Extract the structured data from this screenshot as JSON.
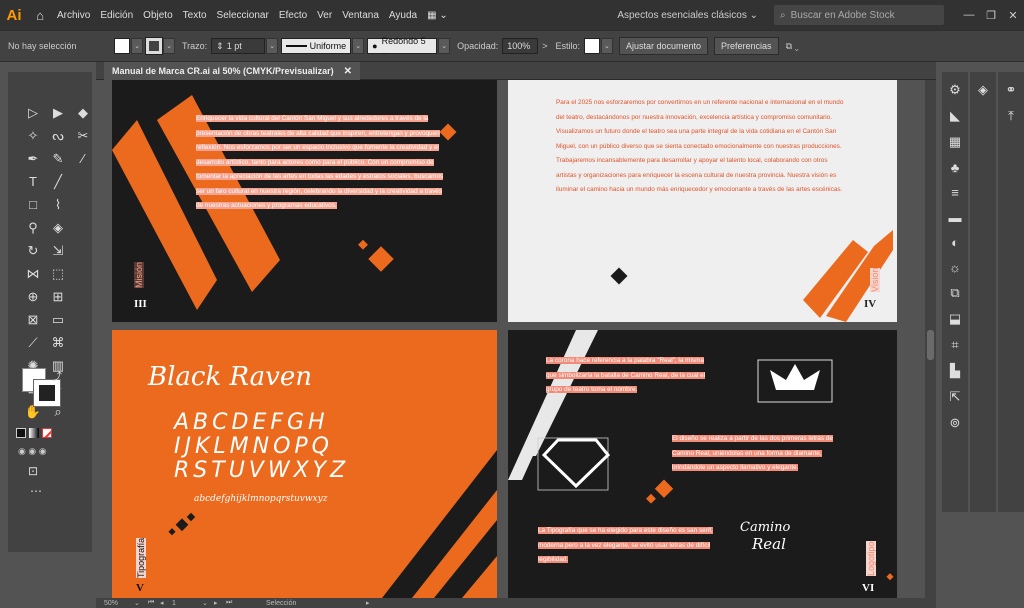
{
  "menubar": {
    "logo": "Ai",
    "items": [
      "Archivo",
      "Edición",
      "Objeto",
      "Texto",
      "Seleccionar",
      "Efecto",
      "Ver",
      "Ventana",
      "Ayuda"
    ],
    "workspace": "Aspectos esenciales clásicos",
    "search_placeholder": "Buscar en Adobe Stock"
  },
  "controlbar": {
    "selection_status": "No hay selección",
    "stroke_label": "Trazo:",
    "stroke_value": "1 pt",
    "profile": "Uniforme",
    "brush": "Redondo 5 ...",
    "opacity_label": "Opacidad:",
    "opacity_value": "100%",
    "style_label": "Estilo:",
    "doc_setup_button": "Ajustar documento",
    "prefs_button": "Preferencias"
  },
  "document": {
    "tab_title": "Manual de Marca CR.ai al 50% (CMYK/Previsualizar)"
  },
  "artboards": {
    "a3": {
      "label": "Misión",
      "number": "III",
      "text": "Enriquecer la vida cultural del Cantón San Miguel y sus alrededores a través de la presentación de obras teatrales de alta calidad que inspiren, entretengan y provoquen reflexión. Nos esforzamos por ser un espacio inclusivo que fomente la creatividad y el desarrollo artístico, tanto para actores como para el público. Con un compromiso de fomentar la apreciación de las artes en todas las edades y estratos sociales, buscamos ser un faro cultural en nuestra región, celebrando la diversidad y la creatividad a través de nuestras actuaciones y programas educativos."
    },
    "a4": {
      "label": "Visión",
      "number": "IV",
      "text": "Para el 2025 nos esforzaremos por convertirnos en un referente nacional e internacional en el mundo del teatro, destacándonos por nuestra innovación, excelencia artística y compromiso comunitario. Visualizamos un futuro donde el teatro sea una parte integral de la vida cotidiana en el Cantón San Miguel, con un público diverso que se sienta conectado emocionalmente con nuestras producciones. Trabajaremos incansablemente para desarrollar y apoyar el talento local, colaborando con otros artistas y organizaciones para enriquecer la escena cultural de nuestra provincia. Nuestra visión es iluminar el camino hacia un mundo más enriquecedor y emocionante a través de las artes escénicas."
    },
    "a5": {
      "label": "Tipografía",
      "number": "V",
      "title": "Black Raven",
      "upper1": "ABCDEFGH",
      "upper2": "IJKLMNOPQ",
      "upper3": "RSTUVWXYZ",
      "lower": "abcdefghijklmnopqrstuvwxyz"
    },
    "a6": {
      "label": "Logotipo",
      "number": "VI",
      "crown_text": "La corona hace referencia a la palabra \"Real\", la misma que simbolizaría la batalla de Camino Real, de la cual el grupo de teatro toma el nombre.",
      "design_text": "El diseño se realiza a partir de las dos primeras letras de Camino Real, uniéndolas en una forma de diamante, brindándole un aspecto llamativo y elegante.",
      "type_text": "La Tipografía que se ha elegido para este diseño es san serif, moderna pero a la vez elegante, se evitó usar letras de difícil legibilidad.",
      "signature_line1": "Camino",
      "signature_line2": "Real"
    }
  },
  "statusbar": {
    "zoom": "50%",
    "page": "1",
    "tool": "Selección"
  },
  "colors": {
    "orange": "#ec6a1e",
    "dark": "#1b1b1b",
    "light": "#efefef",
    "highlight": "#f08c78"
  }
}
